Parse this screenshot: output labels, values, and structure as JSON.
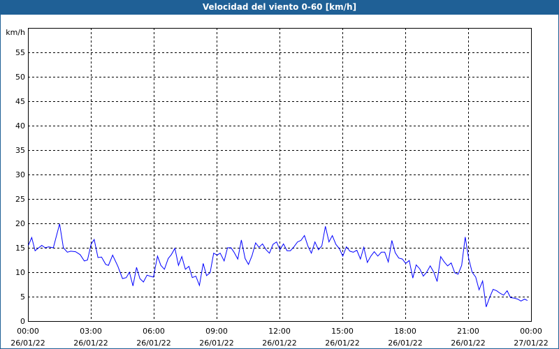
{
  "chart_data": {
    "type": "line",
    "title": "Velocidad del viento 0-60 [km/h]",
    "ylabel": "km/h",
    "xlabel": "",
    "ylim": [
      0,
      60
    ],
    "xlim_hours": [
      0,
      24
    ],
    "grid": true,
    "y_ticks": [
      0,
      5,
      10,
      15,
      20,
      25,
      30,
      35,
      40,
      45,
      50,
      55
    ],
    "x_ticks": [
      {
        "hours": 0,
        "time": "00:00",
        "date": "26/01/22"
      },
      {
        "hours": 3,
        "time": "03:00",
        "date": "26/01/22"
      },
      {
        "hours": 6,
        "time": "06:00",
        "date": "26/01/22"
      },
      {
        "hours": 9,
        "time": "09:00",
        "date": "26/01/22"
      },
      {
        "hours": 12,
        "time": "12:00",
        "date": "26/01/22"
      },
      {
        "hours": 15,
        "time": "15:00",
        "date": "26/01/22"
      },
      {
        "hours": 18,
        "time": "18:00",
        "date": "26/01/22"
      },
      {
        "hours": 21,
        "time": "21:00",
        "date": "26/01/22"
      },
      {
        "hours": 24,
        "time": "00:00",
        "date": "27/01/22"
      }
    ],
    "series": [
      {
        "name": "Velocidad del viento",
        "color": "#0000ff",
        "x_hours": [
          0.02,
          0.18,
          0.34,
          0.66,
          0.82,
          0.99,
          1.21,
          1.51,
          1.69,
          1.88,
          2.04,
          2.27,
          2.49,
          2.69,
          2.84,
          3.01,
          3.16,
          3.34,
          3.51,
          3.71,
          3.84,
          4.04,
          4.29,
          4.51,
          4.69,
          4.84,
          5.01,
          5.18,
          5.34,
          5.51,
          5.68,
          5.82,
          5.99,
          6.04,
          6.18,
          6.34,
          6.51,
          6.69,
          6.84,
          7.01,
          7.18,
          7.34,
          7.51,
          7.68,
          7.84,
          8.01,
          8.18,
          8.36,
          8.52,
          8.69,
          8.86,
          9.02,
          9.17,
          9.36,
          9.52,
          9.69,
          9.83,
          10.01,
          10.18,
          10.36,
          10.52,
          10.69,
          10.86,
          11.02,
          11.19,
          11.36,
          11.52,
          11.69,
          11.86,
          12.02,
          12.19,
          12.36,
          12.52,
          12.69,
          12.86,
          13.02,
          13.19,
          13.36,
          13.52,
          13.69,
          13.86,
          14.02,
          14.19,
          14.36,
          14.52,
          14.69,
          14.86,
          15.02,
          15.19,
          15.36,
          15.52,
          15.69,
          15.86,
          16.02,
          16.19,
          16.36,
          16.52,
          16.69,
          16.86,
          17.02,
          17.19,
          17.36,
          17.52,
          17.69,
          17.86,
          18.02,
          18.19,
          18.36,
          18.52,
          18.69,
          18.86,
          19.02,
          19.19,
          19.36,
          19.52,
          19.69,
          19.86,
          20.02,
          20.19,
          20.36,
          20.52,
          20.69,
          20.86,
          21.02,
          21.19,
          21.36,
          21.52,
          21.69,
          21.86,
          22.02,
          22.19,
          22.36,
          22.52,
          22.69,
          22.86,
          23.02,
          23.19,
          23.36,
          23.52,
          23.69,
          23.83
        ],
        "values": [
          15.5,
          17.1,
          14.4,
          15.5,
          15,
          15.2,
          15,
          19.9,
          15,
          14.1,
          14.3,
          14.2,
          13.6,
          12.3,
          12.5,
          15.7,
          16.7,
          13,
          13.1,
          11.6,
          11.4,
          13.5,
          11.2,
          8.7,
          8.9,
          10,
          7.2,
          11,
          8.7,
          8,
          9.4,
          9.2,
          9,
          10.2,
          13.3,
          11.4,
          10.6,
          12.8,
          13.6,
          14.9,
          11.4,
          13.2,
          10.6,
          11.2,
          8.9,
          9.2,
          7.3,
          11.8,
          9.3,
          9.9,
          13.9,
          13.5,
          13.9,
          12.3,
          15,
          15,
          14.1,
          12.7,
          16.6,
          12.8,
          11.6,
          13.4,
          16,
          15.1,
          15.8,
          14.6,
          13.9,
          15.7,
          16.2,
          14.6,
          15.8,
          14.4,
          14.4,
          15.2,
          16.2,
          16.5,
          17.5,
          15.3,
          13.9,
          16.2,
          14.6,
          15.4,
          19.4,
          16.2,
          17.5,
          15.7,
          14.8,
          13.3,
          15.2,
          14.3,
          14.1,
          14.5,
          12.7,
          15.1,
          12,
          13.3,
          14.2,
          13.3,
          14.1,
          14.1,
          12.1,
          16.5,
          14,
          12.9,
          12.7,
          11.8,
          12.4,
          8.8,
          11.5,
          10.7,
          9.2,
          10,
          11.3,
          10,
          8.1,
          13.2,
          12.1,
          11.3,
          11.9,
          9.9,
          9.6,
          11.4,
          17.2,
          12.9,
          10,
          9,
          6.4,
          8.2,
          2.9,
          4.8,
          6.5,
          6.2,
          5.7,
          5.3,
          6.2,
          4.8,
          4.7,
          4.5,
          4.1,
          4.5,
          4.2
        ]
      }
    ]
  }
}
